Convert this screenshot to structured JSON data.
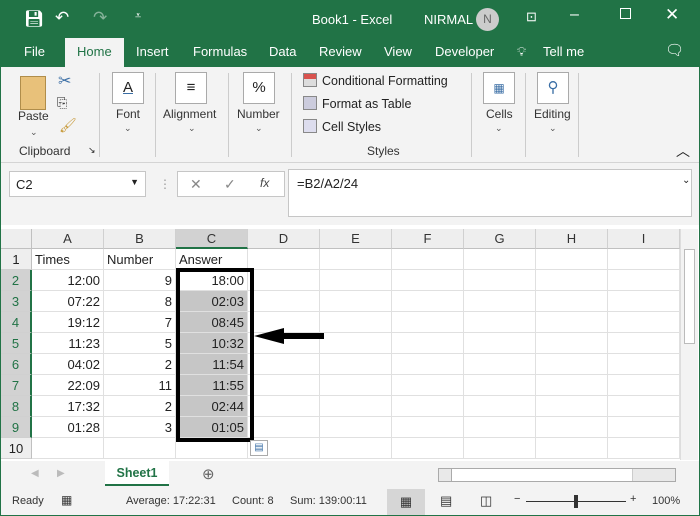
{
  "title_bar": {
    "title": "Book1  -  Excel",
    "user": "NIRMAL",
    "avatar_initial": "N"
  },
  "tabs": [
    {
      "label": "File"
    },
    {
      "label": "Home",
      "active": true
    },
    {
      "label": "Insert"
    },
    {
      "label": "Formulas"
    },
    {
      "label": "Data"
    },
    {
      "label": "Review"
    },
    {
      "label": "View"
    },
    {
      "label": "Developer"
    }
  ],
  "tell_me": "Tell me",
  "ribbon": {
    "paste": "Paste",
    "clipboard": "Clipboard",
    "font": "Font",
    "alignment": "Alignment",
    "number": "Number",
    "number_icon": "%",
    "conditional_formatting": "Conditional Formatting",
    "format_as_table": "Format as Table",
    "cell_styles": "Cell Styles",
    "styles": "Styles",
    "cells": "Cells",
    "editing": "Editing"
  },
  "formula_bar": {
    "name_box": "C2",
    "formula": "=B2/A2/24",
    "fx": "fx"
  },
  "grid": {
    "columns": [
      "A",
      "B",
      "C",
      "D",
      "E",
      "F",
      "G",
      "H",
      "I"
    ],
    "headers": [
      "Times",
      "Number",
      "Answer"
    ],
    "rows": [
      [
        "12:00",
        "9",
        "18:00"
      ],
      [
        "07:22",
        "8",
        "02:03"
      ],
      [
        "19:12",
        "7",
        "08:45"
      ],
      [
        "11:23",
        "5",
        "10:32"
      ],
      [
        "04:02",
        "2",
        "11:54"
      ],
      [
        "22:09",
        "11",
        "11:55"
      ],
      [
        "17:32",
        "2",
        "02:44"
      ],
      [
        "01:28",
        "3",
        "01:05"
      ]
    ],
    "row_numbers": [
      "1",
      "2",
      "3",
      "4",
      "5",
      "6",
      "7",
      "8",
      "9",
      "10"
    ],
    "selected_range": "C2:C9"
  },
  "sheet_tab": "Sheet1",
  "status": {
    "ready": "Ready",
    "average": "Average: 17:22:31",
    "count": "Count: 8",
    "sum": "Sum: 139:00:11",
    "zoom": "100%",
    "zoom_percent": 100
  },
  "colors": {
    "accent": "#217346",
    "selection": "#c6c6c6"
  }
}
